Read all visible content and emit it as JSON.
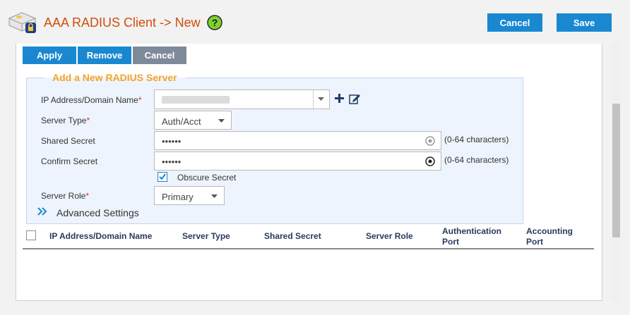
{
  "header": {
    "title": "AAA RADIUS Client -> New",
    "cancel_label": "Cancel",
    "save_label": "Save"
  },
  "actions": {
    "apply": "Apply",
    "remove": "Remove",
    "cancel": "Cancel"
  },
  "form": {
    "legend": "Add a New RADIUS Server",
    "ip": {
      "label": "IP Address/Domain Name",
      "required": "*"
    },
    "server_type": {
      "label": "Server Type",
      "required": "*",
      "value": "Auth/Acct"
    },
    "shared_secret": {
      "label": "Shared Secret",
      "value": "••••••",
      "hint": "(0-64 characters)"
    },
    "confirm_secret": {
      "label": "Confirm Secret",
      "value": "••••••",
      "hint": "(0-64 characters)"
    },
    "obscure_secret": {
      "label": "Obscure Secret",
      "checked": true
    },
    "server_role": {
      "label": "Server Role",
      "required": "*",
      "value": "Primary"
    },
    "advanced_settings": "Advanced Settings"
  },
  "table": {
    "headers": [
      "IP Address/Domain Name",
      "Server Type",
      "Shared Secret",
      "Server Role",
      "Authentication Port",
      "Accounting Port"
    ],
    "rows": []
  },
  "colors": {
    "accent": "#1a88d1",
    "title": "#d24d0b",
    "legend": "#f3a42b",
    "disabled_button": "#7d8a99"
  }
}
